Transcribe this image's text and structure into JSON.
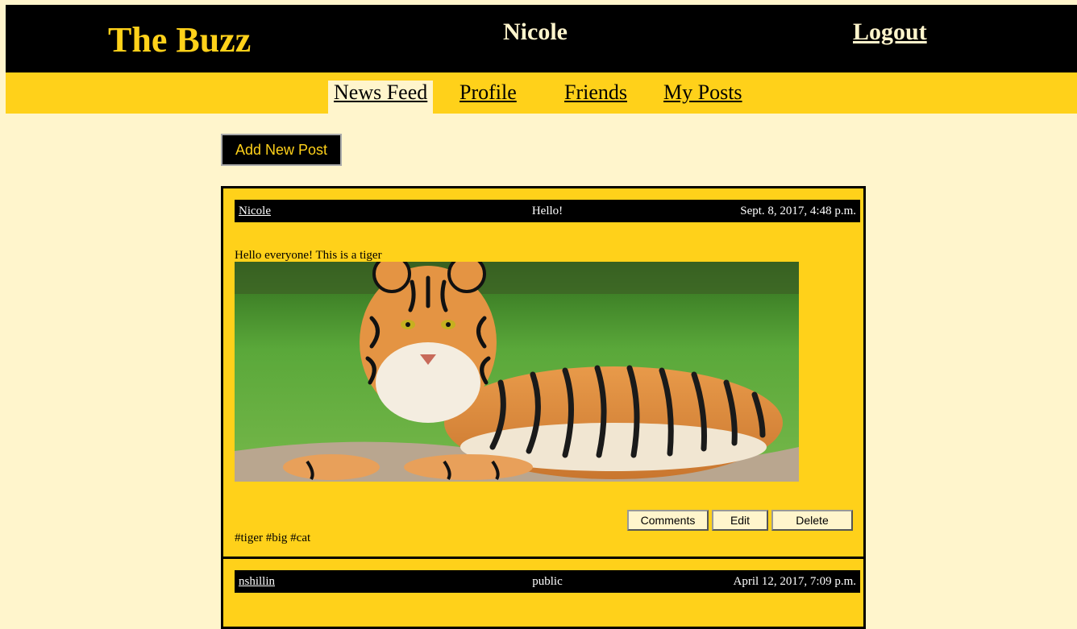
{
  "header": {
    "brand": "The Buzz",
    "username": "Nicole",
    "logout_label": "Logout"
  },
  "nav": {
    "items": [
      {
        "label": "News Feed",
        "active": true
      },
      {
        "label": "Profile",
        "active": false
      },
      {
        "label": "Friends",
        "active": false
      },
      {
        "label": "My Posts",
        "active": false
      }
    ]
  },
  "actions": {
    "add_post_label": "Add New Post"
  },
  "posts": [
    {
      "author": "Nicole",
      "title": "Hello!",
      "date": "Sept. 8, 2017, 4:48 p.m.",
      "body": "Hello everyone! This is a tiger",
      "image": "tiger-photo",
      "tags": "#tiger #big #cat",
      "buttons": {
        "comments": "Comments",
        "edit": "Edit",
        "delete": "Delete"
      }
    },
    {
      "author": "nshillin",
      "title": "public",
      "date": "April 12, 2017, 7:09 p.m."
    }
  ],
  "colors": {
    "page_bg": "#fff5cc",
    "accent": "#ffd11a",
    "header_bg": "#000000"
  }
}
